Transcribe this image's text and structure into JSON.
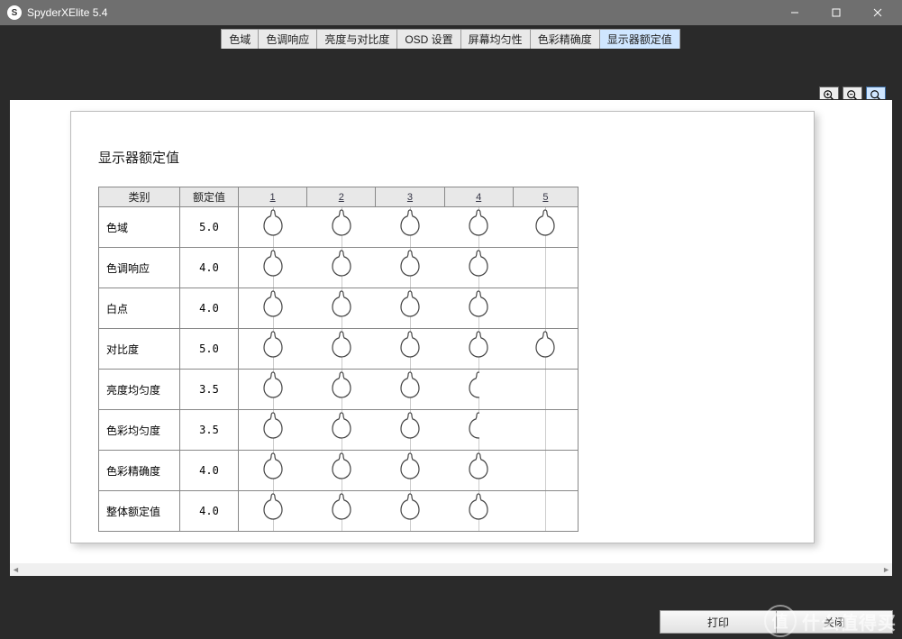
{
  "window": {
    "title": "SpyderXElite 5.4"
  },
  "tabs": [
    {
      "label": "色域",
      "active": false
    },
    {
      "label": "色调响应",
      "active": false
    },
    {
      "label": "亮度与对比度",
      "active": false
    },
    {
      "label": "OSD 设置",
      "active": false
    },
    {
      "label": "屏幕均匀性",
      "active": false
    },
    {
      "label": "色彩精确度",
      "active": false
    },
    {
      "label": "显示器额定值",
      "active": true
    }
  ],
  "page": {
    "title": "显示器额定值",
    "columns": {
      "cat": "类别",
      "val": "额定值"
    },
    "numbers": [
      "1",
      "2",
      "3",
      "4",
      "5"
    ],
    "rows": [
      {
        "cat": "色域",
        "val": "5.0",
        "score": 5.0
      },
      {
        "cat": "色调响应",
        "val": "4.0",
        "score": 4.0
      },
      {
        "cat": "白点",
        "val": "4.0",
        "score": 4.0
      },
      {
        "cat": "对比度",
        "val": "5.0",
        "score": 5.0
      },
      {
        "cat": "亮度均匀度",
        "val": "3.5",
        "score": 3.5
      },
      {
        "cat": "色彩均匀度",
        "val": "3.5",
        "score": 3.5
      },
      {
        "cat": "色彩精确度",
        "val": "4.0",
        "score": 4.0
      },
      {
        "cat": "整体额定值",
        "val": "4.0",
        "score": 4.0
      }
    ]
  },
  "footer": {
    "print": "打印",
    "close": "关闭"
  },
  "watermark": "什么值得买",
  "chart_data": {
    "type": "table",
    "title": "显示器额定值",
    "columns": [
      "类别",
      "额定值"
    ],
    "rows": [
      [
        "色域",
        5.0
      ],
      [
        "色调响应",
        4.0
      ],
      [
        "白点",
        4.0
      ],
      [
        "对比度",
        5.0
      ],
      [
        "亮度均匀度",
        3.5
      ],
      [
        "色彩均匀度",
        3.5
      ],
      [
        "色彩精确度",
        4.0
      ],
      [
        "整体额定值",
        4.0
      ]
    ],
    "scale_max": 5
  }
}
